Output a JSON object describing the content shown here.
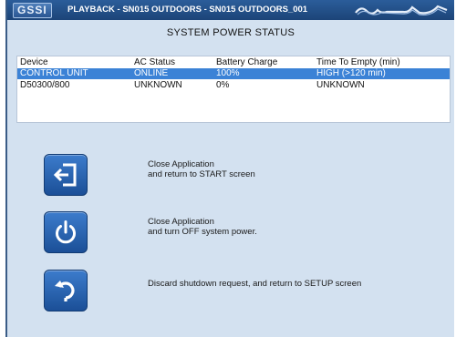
{
  "window": {
    "logo_text": "GSSI",
    "title": "PLAYBACK - SN015 OUTDOORS - SN015 OUTDOORS_001"
  },
  "page_title": "SYSTEM POWER STATUS",
  "status_table": {
    "headers": [
      "Device",
      "AC Status",
      "Battery Charge",
      "Time To Empty (min)"
    ],
    "rows": [
      [
        "CONTROL UNIT",
        "ONLINE",
        "100%",
        "HIGH (>120 min)"
      ],
      [
        "D50300/800",
        "UNKNOWN",
        " 0%",
        "UNKNOWN"
      ]
    ],
    "selected_row": 0
  },
  "actions": [
    {
      "icon": "exit-icon",
      "lines": [
        "Close Application",
        "and return to START screen"
      ]
    },
    {
      "icon": "power-icon",
      "lines": [
        "Close Application",
        "and turn OFF system power."
      ]
    },
    {
      "icon": "return-icon",
      "lines": [
        "Discard shutdown request, and return to SETUP screen"
      ]
    }
  ],
  "colors": {
    "titlebar": "#1c4478",
    "background": "#d3e1f0",
    "selection": "#3b82d6",
    "button": "#2a64b0"
  }
}
